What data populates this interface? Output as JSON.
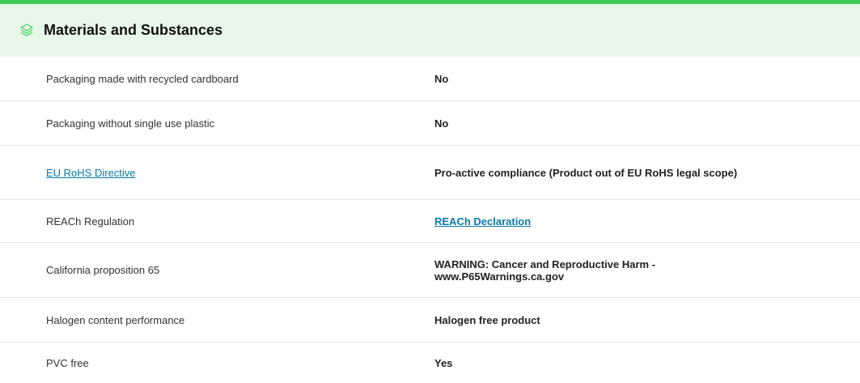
{
  "section": {
    "title": "Materials and Substances",
    "icon": "layers-icon",
    "accent_color": "#3dcd58",
    "header_bg": "#e8f8e8",
    "link_color": "#0a7aa8"
  },
  "rows": [
    {
      "label": "Packaging made with recycled cardboard",
      "value": "No"
    },
    {
      "label": "Packaging without single use plastic",
      "value": "No"
    },
    {
      "label": "EU RoHS Directive",
      "value": "Pro-active compliance (Product out of EU RoHS legal scope)"
    },
    {
      "label": "REACh Regulation",
      "value": "REACh Declaration"
    },
    {
      "label": "California proposition 65",
      "value": "WARNING: Cancer and Reproductive Harm - www.P65Warnings.ca.gov"
    },
    {
      "label": "Halogen content performance",
      "value": "Halogen free product"
    },
    {
      "label": "PVC free",
      "value": "Yes"
    }
  ]
}
